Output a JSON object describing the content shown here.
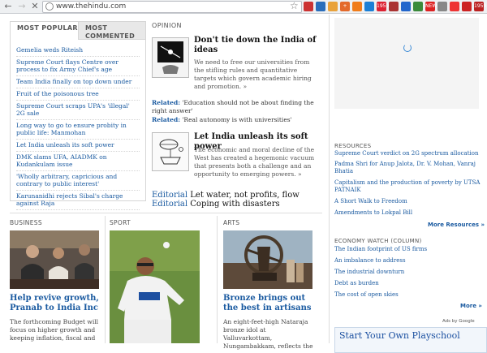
{
  "browser": {
    "url": "www.thehindu.com",
    "back_icon": "←",
    "forward_icon": "→",
    "close_icon": "✕",
    "bookmark_icon": "☆",
    "extensions": [
      {
        "name": "ext-icon-1",
        "color": "#c33",
        "label": ""
      },
      {
        "name": "ext-icon-2",
        "color": "#2a6ebb",
        "label": ""
      },
      {
        "name": "ext-icon-3",
        "color": "#e9a23b",
        "label": ""
      },
      {
        "name": "ext-icon-4",
        "color": "#e46a2b",
        "label": "+"
      },
      {
        "name": "ext-icon-5",
        "color": "#f07c1a",
        "label": ""
      },
      {
        "name": "ext-icon-6",
        "color": "#1b7fd6",
        "label": ""
      },
      {
        "name": "ext-icon-7",
        "color": "#d23",
        "label": "1959"
      },
      {
        "name": "ext-icon-8",
        "color": "#a33",
        "label": ""
      },
      {
        "name": "ext-icon-9",
        "color": "#2266cc",
        "label": ""
      },
      {
        "name": "ext-icon-10",
        "color": "#3b8a3b",
        "label": ""
      },
      {
        "name": "ext-icon-11",
        "color": "#d22",
        "label": "NEW"
      },
      {
        "name": "ext-icon-12",
        "color": "#888",
        "label": ""
      },
      {
        "name": "ext-icon-13",
        "color": "#e33",
        "label": ""
      },
      {
        "name": "ext-icon-14",
        "color": "#cc2222",
        "label": ""
      },
      {
        "name": "ext-icon-15",
        "color": "#b22",
        "label": "1959"
      }
    ]
  },
  "most_popular": {
    "tab_popular": "MOST POPULAR",
    "tab_commented": "MOST COMMENTED",
    "items": [
      "Gemelia weds Riteish",
      "Supreme Court flays Centre over process to fix Army Chief's age",
      "Team India finally on top down under",
      "Fruit of the poisonous tree",
      "Supreme Court scraps UPA's 'illegal' 2G sale",
      "Long way to go to ensure probity in public life: Manmohan",
      "Let India unleash its soft power",
      "DMK slams UFA, AIADMK on Kudankulam issue",
      "'Wholly arbitrary, capricious and contrary to public interest'",
      "Karunanidhi rejects Sibal's charge against Raja"
    ]
  },
  "opinion": {
    "section": "OPINION",
    "article1": {
      "headline": "Don't tie down the India of ideas",
      "body": "We need to free our universities from the stifling rules and quantitative targets which govern academic hiring and promotion. »",
      "related1_label": "Related:",
      "related1_text": "'Education should not be about finding the right answer'",
      "related2_label": "Related:",
      "related2_text": "'Real autonomy is with universities'"
    },
    "article2": {
      "headline": "Let India unleash its soft power",
      "body": "The economic and moral decline of the West has created a hegemonic vacuum that presents both a challenge and an opportunity to emerging powers. »"
    },
    "editorial1_label": "Editorial",
    "editorial1_text": "Let water, not profits, flow",
    "editorial2_label": "Editorial",
    "editorial2_text": "Coping with disasters"
  },
  "business": {
    "section": "BUSINESS",
    "headline": "Help revive growth, Pranab to India Inc",
    "body": "The forthcoming Budget will focus on higher growth and keeping inflation, fiscal and"
  },
  "sport": {
    "section": "SPORT"
  },
  "arts": {
    "section": "ARTS",
    "headline": "Bronze brings out the best in artisans",
    "body": "An eight-feet-high Nataraja bronze idol at Valluvarkottam, Nungambakkam, reflects the"
  },
  "resources": {
    "section": "RESOURCES",
    "items": [
      "Supreme Court verdict on 2G spectrum allocation",
      "Padma Shri for Anup Jalota, Dr. V. Mohan, Vanraj Bhatia",
      "Capitalism and the production of poverty by UTSA PATNAIK",
      "A Short Walk to Freedom",
      "Amendments to Lokpal Bill"
    ],
    "more": "More Resources »"
  },
  "economy": {
    "section": "ECONOMY WATCH (COLUMN)",
    "items": [
      "The Indian footprint of US firms",
      "An imbalance to address",
      "The industrial downturn",
      "Debt as burden",
      "The cost of open skies"
    ],
    "more": "More »"
  },
  "ads": {
    "ads_by": "Ads by Google",
    "headline": "Start Your Own Playschool"
  }
}
